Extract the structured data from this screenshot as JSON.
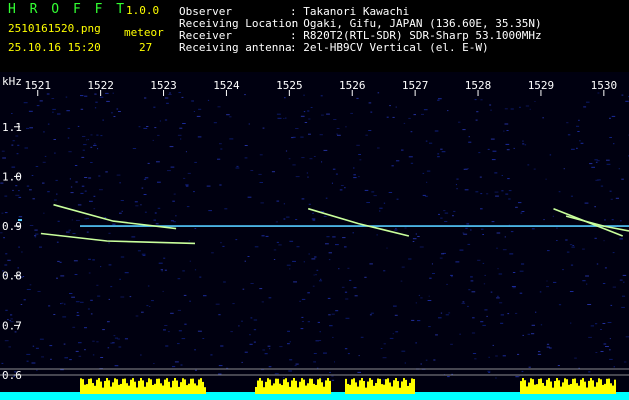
{
  "header": {
    "app_title": "H R O F F T",
    "version": "1.0.0",
    "filename": "2510161520.png",
    "datetime": "25.10.16 15:20",
    "counter_label": "meteor",
    "counter_value": "27",
    "info": [
      {
        "label": "Observer",
        "value": ": Takanori Kawachi"
      },
      {
        "label": "Receiving Location",
        "value": ": Ogaki, Gifu, JAPAN (136.60E, 35.35N)"
      },
      {
        "label": "Receiver",
        "value": ": R820T2(RTL-SDR) SDR-Sharp 53.1000MHz"
      },
      {
        "label": "Receiving antenna",
        "value": ": 2el-HB9CV Vertical (el. E-W)"
      }
    ]
  },
  "chart_data": {
    "type": "heatmap",
    "ylabel": "kHz",
    "x_ticks": [
      "1521",
      "1522",
      "1523",
      "1524",
      "1525",
      "1526",
      "1527",
      "1528",
      "1529",
      "1530"
    ],
    "y_ticks": [
      "1.1",
      "1.0",
      "0.9",
      "0.8",
      "0.7",
      "0.6"
    ],
    "xlim": [
      1520.4,
      1530.4
    ],
    "ylim": [
      0.59,
      1.17
    ],
    "carrier_khz": 0.9,
    "meteor_traces": [
      {
        "x": [
          1521.25,
          1522.2,
          1523.2
        ],
        "y": [
          0.943,
          0.91,
          0.895
        ]
      },
      {
        "x": [
          1521.05,
          1522.1,
          1523.5
        ],
        "y": [
          0.885,
          0.87,
          0.865
        ]
      },
      {
        "x": [
          1525.3,
          1526.1,
          1526.9
        ],
        "y": [
          0.935,
          0.905,
          0.88
        ]
      },
      {
        "x": [
          1529.2,
          1529.8,
          1530.3
        ],
        "y": [
          0.935,
          0.905,
          0.88
        ]
      },
      {
        "x": [
          1529.4,
          1530.0,
          1530.4
        ],
        "y": [
          0.92,
          0.9,
          0.89
        ]
      }
    ],
    "colors": {
      "carrier": "#55ccff",
      "trace": "#c9ff9c",
      "axis_text": "#ffffff",
      "signal_bar": "#ffff00",
      "signal_base": "#00ffff"
    }
  }
}
